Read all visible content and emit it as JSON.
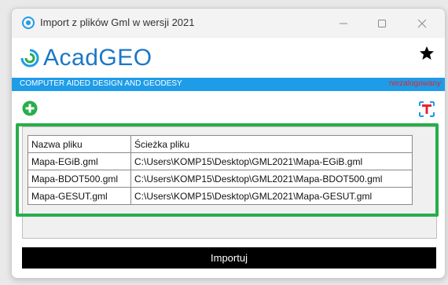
{
  "window": {
    "title": "Import z plików Gml w wersji 2021",
    "minimize_icon": "minimize-icon",
    "maximize_icon": "maximize-icon",
    "close_icon": "close-icon"
  },
  "brand": {
    "logo_text": "AcadGEO",
    "tagline": "COMPUTER AIDED DESIGN AND GEODESY",
    "login_status": "niezalogowany",
    "accent_color": "#1f9ce8",
    "status_color": "#e0282e"
  },
  "toolbar": {
    "add_icon": "add-circle-icon",
    "t_icon": "t-icon",
    "star_icon": "star-icon"
  },
  "table": {
    "headers": [
      "Nazwa pliku",
      "Ścieżka pliku"
    ],
    "rows": [
      [
        "Mapa-EGiB.gml",
        "C:\\Users\\KOMP15\\Desktop\\GML2021\\Mapa-EGiB.gml"
      ],
      [
        "Mapa-BDOT500.gml",
        "C:\\Users\\KOMP15\\Desktop\\GML2021\\Mapa-BDOT500.gml"
      ],
      [
        "Mapa-GESUT.gml",
        "C:\\Users\\KOMP15\\Desktop\\GML2021\\Mapa-GESUT.gml"
      ]
    ],
    "highlight_color": "#27ae4a"
  },
  "actions": {
    "import_label": "Importuj"
  }
}
